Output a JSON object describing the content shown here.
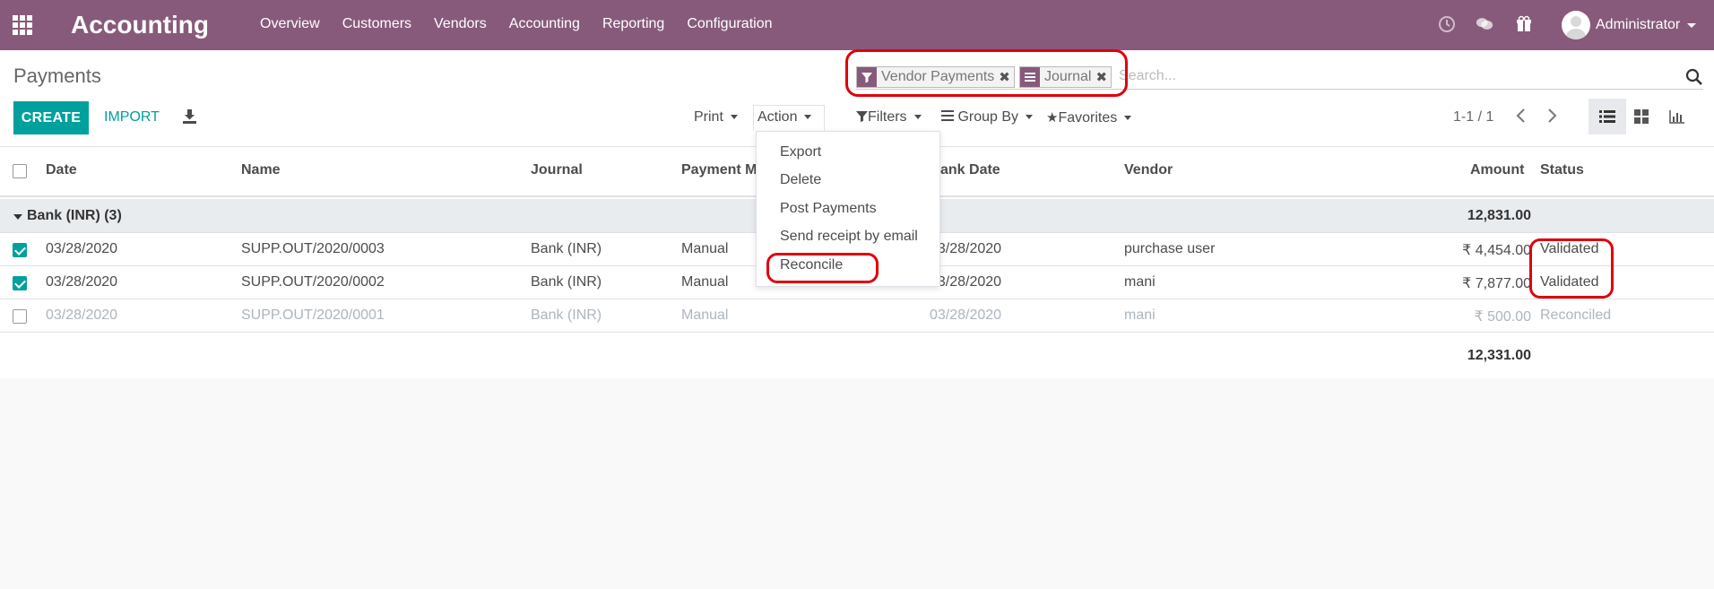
{
  "navbar": {
    "brand": "Accounting",
    "menu": [
      "Overview",
      "Customers",
      "Vendors",
      "Accounting",
      "Reporting",
      "Configuration"
    ],
    "user": "Administrator",
    "icons": [
      "apps-icon",
      "clock-icon",
      "chat-icon",
      "gift-icon"
    ]
  },
  "control": {
    "title": "Payments",
    "create_label": "CREATE",
    "import_label": "IMPORT",
    "search": {
      "facets": [
        {
          "icon": "filter-icon",
          "label": "Vendor Payments"
        },
        {
          "icon": "groupby-icon",
          "label": "Journal"
        }
      ],
      "placeholder": "Search..."
    },
    "print_label": "Print",
    "action_label": "Action",
    "filters_label": "Filters",
    "groupby_label": "Group By",
    "favorites_label": "Favorites",
    "pager": "1-1 / 1",
    "views": [
      "list",
      "kanban",
      "graph"
    ]
  },
  "table": {
    "columns": [
      "Date",
      "Name",
      "Journal",
      "Payment M",
      "ank Date",
      "Vendor",
      "Amount",
      "Status"
    ],
    "group": {
      "label": "Bank (INR) (3)",
      "total": "12,831.00"
    },
    "rows": [
      {
        "checked": true,
        "date": "03/28/2020",
        "name": "SUPP.OUT/2020/0003",
        "journal": "Bank (INR)",
        "method": "Manual",
        "bank_date": "03/28/2020",
        "vendor": "purchase user",
        "amount": "₹ 4,454.00",
        "status": "Validated"
      },
      {
        "checked": true,
        "date": "03/28/2020",
        "name": "SUPP.OUT/2020/0002",
        "journal": "Bank (INR)",
        "method": "Manual",
        "bank_date": "03/28/2020",
        "vendor": "mani",
        "amount": "₹ 7,877.00",
        "status": "Validated"
      },
      {
        "checked": false,
        "date": "03/28/2020",
        "name": "SUPP.OUT/2020/0001",
        "journal": "Bank (INR)",
        "method": "Manual",
        "bank_date": "03/28/2020",
        "vendor": "mani",
        "amount": "₹ 500.00",
        "status": "Reconciled"
      }
    ],
    "footer_total": "12,331.00"
  },
  "action_menu": {
    "items": [
      "Export",
      "Delete",
      "Post Payments",
      "Send receipt by email",
      "Reconcile"
    ]
  },
  "colors": {
    "brand": "#875a7b",
    "primary": "#00a09d",
    "annotation": "#e0000c"
  }
}
